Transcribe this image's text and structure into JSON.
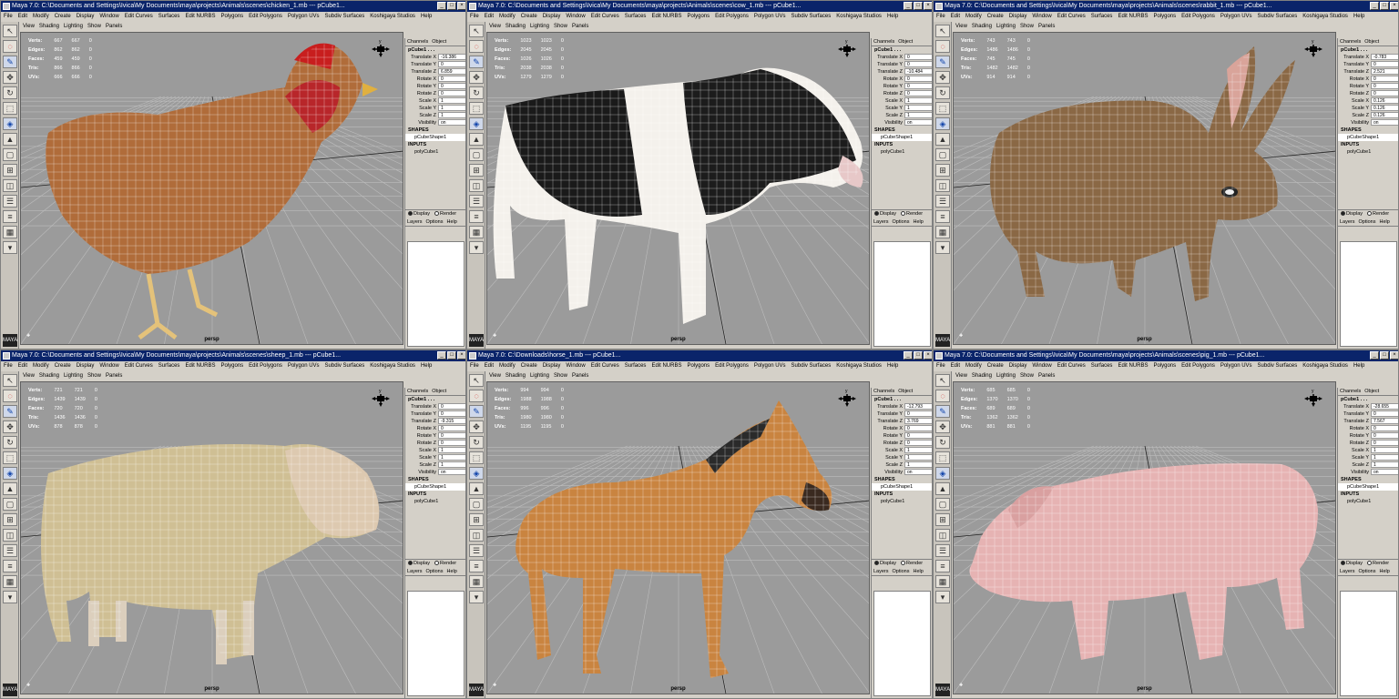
{
  "colors": {
    "title_bg": "#0a246a",
    "viewport_bg": "#9b9b9b",
    "ui_bg": "#d4d0c8"
  },
  "main_menu": [
    "File",
    "Edit",
    "Modify",
    "Create",
    "Display",
    "Window",
    "Edit Curves",
    "Surfaces",
    "Edit NURBS",
    "Polygons",
    "Edit Polygons",
    "Polygon UVs",
    "Subdiv Surfaces",
    "Koshigaya Studios",
    "Help"
  ],
  "panel_menu": [
    "View",
    "Shading",
    "Lighting",
    "Show",
    "Panels"
  ],
  "hud_labels": [
    "Verts:",
    "Edges:",
    "Faces:",
    "Tris:",
    "UVs:"
  ],
  "channel_tabs": [
    "Channels",
    "Object"
  ],
  "channel_labels": [
    "Translate X",
    "Translate Y",
    "Translate Z",
    "Rotate X",
    "Rotate Y",
    "Rotate Z",
    "Scale X",
    "Scale Y",
    "Scale Z",
    "Visibility"
  ],
  "shapes_label": "SHAPES",
  "inputs_label": "INPUTS",
  "layer_display": "Display",
  "layer_render": "Render",
  "layer_menu": [
    "Layers",
    "Options",
    "Help"
  ],
  "windows": [
    {
      "title": "Maya 7.0: C:\\Documents and Settings\\Ivica\\My Documents\\maya\\projects\\Animals\\scenes\\chicken_1.mb  ---  pCube1...",
      "hud": [
        [
          "667",
          "667",
          "0"
        ],
        [
          "862",
          "862",
          "0"
        ],
        [
          "459",
          "459",
          "0"
        ],
        [
          "866",
          "866",
          "0"
        ],
        [
          "666",
          "666",
          "0"
        ]
      ],
      "object": "pCube1 . . .",
      "channels": [
        "-16.386",
        "0",
        "6.859",
        "0",
        "0",
        "0",
        "1",
        "1",
        "1",
        "on"
      ],
      "shape": "pCubeShape1",
      "input": "polyCube1",
      "camera": "persp",
      "animal": "chicken"
    },
    {
      "title": "Maya 7.0: C:\\Documents and Settings\\Ivica\\My Documents\\maya\\projects\\Animals\\scenes\\cow_1.mb  ---  pCube1...",
      "hud": [
        [
          "1023",
          "1023",
          "0"
        ],
        [
          "2045",
          "2045",
          "0"
        ],
        [
          "1026",
          "1026",
          "0"
        ],
        [
          "2038",
          "2038",
          "0"
        ],
        [
          "1279",
          "1279",
          "0"
        ]
      ],
      "object": "pCube1 . . .",
      "channels": [
        "0",
        "0",
        "-10.484",
        "0",
        "0",
        "0",
        "1",
        "1",
        "1",
        "on"
      ],
      "shape": "pCubeShape1",
      "input": "polyCube1",
      "camera": "persp",
      "animal": "cow"
    },
    {
      "title": "Maya 7.0: C:\\Documents and Settings\\Ivica\\My Documents\\maya\\projects\\Animals\\scenes\\rabbit_1.mb  ---  pCube1...",
      "hud": [
        [
          "743",
          "743",
          "0"
        ],
        [
          "1486",
          "1486",
          "0"
        ],
        [
          "745",
          "745",
          "0"
        ],
        [
          "1482",
          "1482",
          "0"
        ],
        [
          "914",
          "914",
          "0"
        ]
      ],
      "object": "pCube1 . . .",
      "channels": [
        "-0.783",
        "0",
        "2.521",
        "0",
        "0",
        "0",
        "0.126",
        "0.126",
        "0.126",
        "on"
      ],
      "shape": "pCubeShape1",
      "input": "polyCube1",
      "camera": "persp",
      "animal": "rabbit"
    },
    {
      "title": "Maya 7.0: C:\\Documents and Settings\\Ivica\\My Documents\\maya\\projects\\Animals\\scenes\\sheep_1.mb  ---  pCube1...",
      "hud": [
        [
          "721",
          "721",
          "0"
        ],
        [
          "1439",
          "1439",
          "0"
        ],
        [
          "720",
          "720",
          "0"
        ],
        [
          "1436",
          "1436",
          "0"
        ],
        [
          "878",
          "878",
          "0"
        ]
      ],
      "object": "pCube1 . . .",
      "channels": [
        "0",
        "0",
        "-9.315",
        "0",
        "0",
        "0",
        "1",
        "1",
        "1",
        "on"
      ],
      "shape": "pCubeShape1",
      "input": "polyCube1",
      "camera": "persp",
      "animal": "sheep"
    },
    {
      "title": "Maya 7.0: C:\\Downloads\\horse_1.mb  ---  pCube1...",
      "hud": [
        [
          "994",
          "994",
          "0"
        ],
        [
          "1988",
          "1988",
          "0"
        ],
        [
          "996",
          "996",
          "0"
        ],
        [
          "1980",
          "1980",
          "0"
        ],
        [
          "1195",
          "1195",
          "0"
        ]
      ],
      "object": "pCube1 . . .",
      "channels": [
        "-12.793",
        "0",
        "3.769",
        "0",
        "0",
        "0",
        "1",
        "1",
        "1",
        "on"
      ],
      "shape": "pCubeShape1",
      "input": "polyCube1",
      "camera": "persp",
      "animal": "horse"
    },
    {
      "title": "Maya 7.0: C:\\Documents and Settings\\Ivica\\My Documents\\maya\\projects\\Animals\\scenes\\pig_1.mb  ---  pCube1...",
      "hud": [
        [
          "685",
          "685",
          "0"
        ],
        [
          "1370",
          "1370",
          "0"
        ],
        [
          "689",
          "689",
          "0"
        ],
        [
          "1362",
          "1362",
          "0"
        ],
        [
          "881",
          "881",
          "0"
        ]
      ],
      "object": "pCube1 . . .",
      "channels": [
        "-28.655",
        "0",
        "7.567",
        "0",
        "0",
        "0",
        "1",
        "1",
        "1",
        "on"
      ],
      "shape": "pCubeShape1",
      "input": "polyCube1",
      "camera": "persp",
      "animal": "pig"
    }
  ]
}
